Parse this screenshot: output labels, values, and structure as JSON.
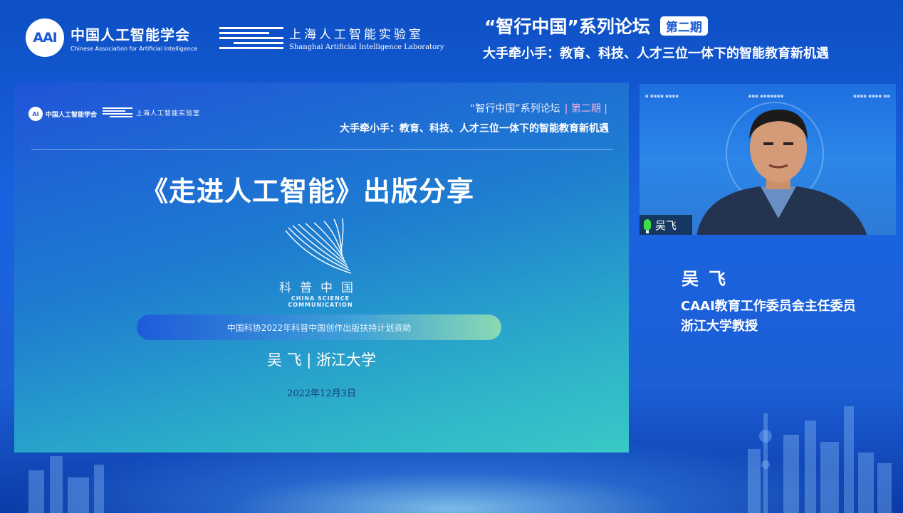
{
  "header": {
    "caai_badge": "AAI",
    "caai_name_cn": "中国人工智能学会",
    "caai_name_en": "Chinese Association for Artificial Intelligence",
    "sail_name_cn": "上海人工智能实验室",
    "sail_name_en": "Shanghai Artificial Intelligence Laboratory",
    "forum_title": "“智行中国”系列论坛",
    "issue_badge": "第二期",
    "forum_subtitle": "大手牵小手：教育、科技、人才三位一体下的智能教育新机遇"
  },
  "slide": {
    "caai_badge": "AI",
    "caai_name_cn": "中国人工智能学会",
    "sail_name_cn": "上海人工智能实验室",
    "forum_title": "“智行中国”系列论坛",
    "issue": "| 第二期 |",
    "subtitle": "大手牵小手：教育、科技、人才三位一体下的智能教育新机遇",
    "main_title": "《走进人工智能》出版分享",
    "kepu_cn": "科普中国",
    "kepu_en": "CHINA SCIENCE COMMUNICATION",
    "funding_note": "中国科协2022年科普中国创作出版扶持计划资助",
    "author_line": "吴 飞 | 浙江大学",
    "date": "2022年12月3日"
  },
  "camera": {
    "participant_name": "吴飞"
  },
  "speaker": {
    "name": "吴飞",
    "title": "CAAI教育工作委员会主任委员",
    "affiliation": "浙江大学教授"
  }
}
